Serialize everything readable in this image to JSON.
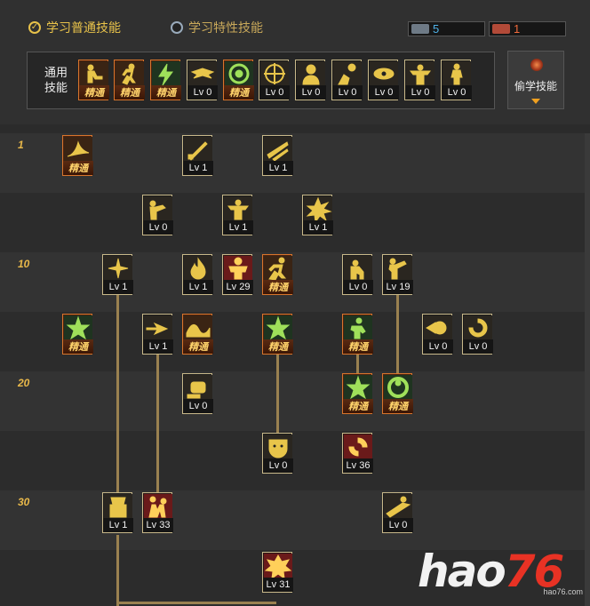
{
  "tabs": [
    {
      "label": "学习普通技能",
      "selected": true
    },
    {
      "label": "学习特性技能",
      "selected": false
    }
  ],
  "points": {
    "normal": "5",
    "special": "1"
  },
  "common": {
    "label_line1": "通用",
    "label_line2": "技能",
    "skills": [
      {
        "cap": "精通",
        "style": "master",
        "glyph": "person-sit"
      },
      {
        "cap": "精通",
        "style": "master",
        "glyph": "person-run"
      },
      {
        "cap": "精通",
        "style": "master",
        "glyph": "bolt-green"
      },
      {
        "cap": "Lv 0",
        "style": "normal",
        "glyph": "wings"
      },
      {
        "cap": "精通",
        "style": "master",
        "glyph": "target-green"
      },
      {
        "cap": "Lv 0",
        "style": "normal",
        "glyph": "target"
      },
      {
        "cap": "Lv 0",
        "style": "normal",
        "glyph": "person-hood"
      },
      {
        "cap": "Lv 0",
        "style": "normal",
        "glyph": "person-gear"
      },
      {
        "cap": "Lv 0",
        "style": "normal",
        "glyph": "eye"
      },
      {
        "cap": "Lv 0",
        "style": "normal",
        "glyph": "strong"
      },
      {
        "cap": "Lv 0",
        "style": "normal",
        "glyph": "person-stand"
      }
    ]
  },
  "steal": {
    "label": "偷学技能"
  },
  "levels": [
    "1",
    "10",
    "20",
    "30"
  ],
  "tree": {
    "skills": [
      {
        "cap": "精通",
        "style": "master",
        "glyph": "wing"
      },
      {
        "cap": "Lv 1",
        "style": "normal",
        "glyph": "blade"
      },
      {
        "cap": "Lv 1",
        "style": "normal",
        "glyph": "slash"
      },
      {
        "cap": "Lv 0",
        "style": "normal",
        "glyph": "punch"
      },
      {
        "cap": "Lv 1",
        "style": "normal",
        "glyph": "strong"
      },
      {
        "cap": "Lv 1",
        "style": "normal",
        "glyph": "burst"
      },
      {
        "cap": "Lv 1",
        "style": "normal",
        "glyph": "spark"
      },
      {
        "cap": "Lv 1",
        "style": "normal",
        "glyph": "flame"
      },
      {
        "cap": "Lv 29",
        "style": "ult",
        "glyph": "giant"
      },
      {
        "cap": "精通",
        "style": "master",
        "glyph": "runner"
      },
      {
        "cap": "Lv 0",
        "style": "normal",
        "glyph": "crouch"
      },
      {
        "cap": "Lv 19",
        "style": "normal",
        "glyph": "kick"
      },
      {
        "cap": "精通",
        "style": "master",
        "glyph": "star-green"
      },
      {
        "cap": "Lv 1",
        "style": "normal",
        "glyph": "dash"
      },
      {
        "cap": "精通",
        "style": "master",
        "glyph": "wave"
      },
      {
        "cap": "精通",
        "style": "master",
        "glyph": "star-green"
      },
      {
        "cap": "精通",
        "style": "master",
        "glyph": "fighter-green"
      },
      {
        "cap": "Lv 0",
        "style": "normal",
        "glyph": "fireball"
      },
      {
        "cap": "Lv 0",
        "style": "normal",
        "glyph": "swirl"
      },
      {
        "cap": "Lv 0",
        "style": "normal",
        "glyph": "fist"
      },
      {
        "cap": "精通",
        "style": "master",
        "glyph": "star-green"
      },
      {
        "cap": "精通",
        "style": "master",
        "glyph": "ring-green"
      },
      {
        "cap": "Lv 0",
        "style": "normal",
        "glyph": "mask"
      },
      {
        "cap": "Lv 36",
        "style": "ult",
        "glyph": "spin"
      },
      {
        "cap": "Lv 1",
        "style": "normal",
        "glyph": "armor"
      },
      {
        "cap": "Lv 33",
        "style": "ult",
        "glyph": "duel"
      },
      {
        "cap": "Lv 0",
        "style": "normal",
        "glyph": "slide"
      },
      {
        "cap": "Lv 31",
        "style": "ult",
        "glyph": "explode"
      }
    ]
  },
  "watermark": {
    "big_prefix": "hao",
    "big_num": "76",
    "small": "hao76.com"
  }
}
